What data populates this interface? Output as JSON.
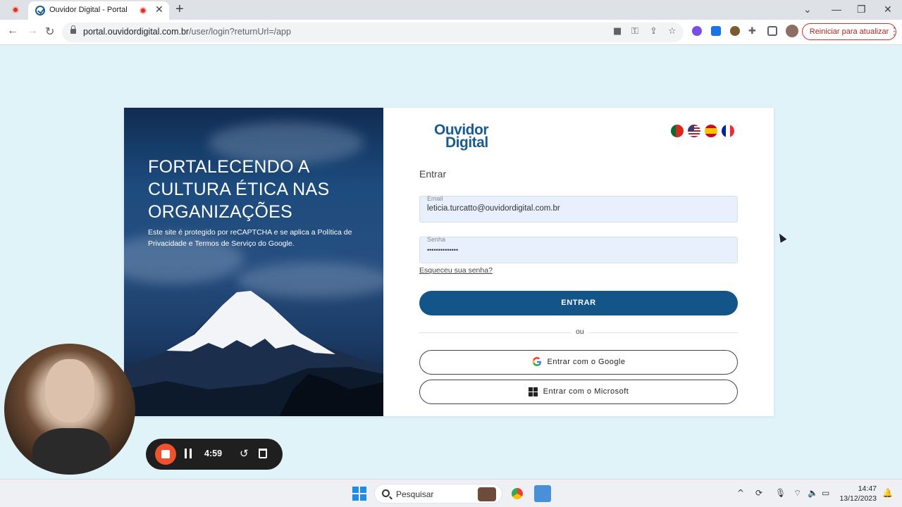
{
  "browser": {
    "tab_title": "Ouvidor Digital - Portal",
    "url_host": "portal.ouvidordigital.com.br",
    "url_path": "/user/login?returnUrl=/app",
    "restart_label": "Reiniciar para atualizar"
  },
  "hero": {
    "title": "FORTALECENDO A CULTURA ÉTICA NAS ORGANIZAÇÕES",
    "subtitle": "Este site é protegido por reCAPTCHA e se aplica a Política de Privacidade e Termos de Serviço do Google."
  },
  "logo": {
    "line1": "Ouvidor",
    "line2": "Digital"
  },
  "languages": [
    "pt",
    "en",
    "es",
    "fr"
  ],
  "form": {
    "title": "Entrar",
    "email_label": "Email",
    "email_value": "leticia.turcatto@ouvidordigital.com.br",
    "password_label": "Senha",
    "password_value": "••••••••••••••",
    "forgot_label": "Esqueceu sua senha?",
    "submit_label": "ENTRAR",
    "divider_label": "ou",
    "google_label": "Entrar com o Google",
    "microsoft_label": "Entrar com o Microsoft"
  },
  "recorder": {
    "time": "4:59"
  },
  "taskbar": {
    "search_placeholder": "Pesquisar",
    "time": "14:47",
    "date": "13/12/2023"
  },
  "colors": {
    "primary": "#135589",
    "background": "#dff3f9",
    "accent_red": "#d93025"
  }
}
